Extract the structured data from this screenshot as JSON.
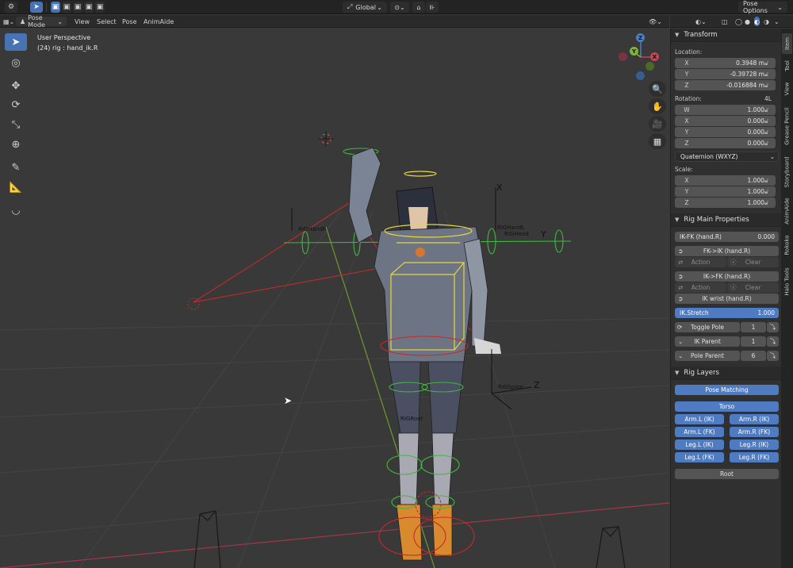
{
  "topbar": {
    "transform_orientation": "Global",
    "pose_options": "Pose Options"
  },
  "header": {
    "mode": "Pose Mode",
    "menu": [
      "View",
      "Select",
      "Pose",
      "AnimAide"
    ]
  },
  "viewport": {
    "view_name": "User Perspective",
    "object_info": "(24) rig : hand_ik.R",
    "bone_labels": [
      "RIGHandR",
      "RIGHandL",
      "RIGHead",
      "RIGSpine",
      "RIGRoot"
    ],
    "axis_labels": [
      "X",
      "Y",
      "Z"
    ],
    "gizmo": {
      "x": "X",
      "y": "Y",
      "z": "Z"
    },
    "colors": {
      "x_axis": "#c44454",
      "y_axis": "#7fb23b",
      "z_axis": "#4a7fc1",
      "bone_select": "#e8d83a",
      "bone_green": "#3fb93f",
      "bone_red": "#c42a2a"
    }
  },
  "toolbar": {
    "tools": [
      "select-box-icon",
      "cursor-icon",
      "move-icon",
      "rotate-icon",
      "scale-icon",
      "transform-icon",
      "annotate-icon",
      "measure-icon",
      "relax-icon"
    ]
  },
  "panel": {
    "transform": {
      "title": "Transform",
      "location_label": "Location:",
      "location": [
        {
          "axis": "X",
          "value": "0.3948 m"
        },
        {
          "axis": "Y",
          "value": "-0.39728 m"
        },
        {
          "axis": "Z",
          "value": "-0.016884 m"
        }
      ],
      "rotation_label": "Rotation:",
      "rotation_tag": "4L",
      "rotation": [
        {
          "axis": "W",
          "value": "1.000"
        },
        {
          "axis": "X",
          "value": "0.000"
        },
        {
          "axis": "Y",
          "value": "0.000"
        },
        {
          "axis": "Z",
          "value": "0.000"
        }
      ],
      "rotation_mode": "Quaternion (WXYZ)",
      "scale_label": "Scale:",
      "scale": [
        {
          "axis": "X",
          "value": "1.000"
        },
        {
          "axis": "Y",
          "value": "1.000"
        },
        {
          "axis": "Z",
          "value": "1.000"
        }
      ]
    },
    "rig_main": {
      "title": "Rig Main Properties",
      "ikfk_label": "IK-FK (hand.R)",
      "ikfk_value": "0.000",
      "fk_to_ik": "FK->IK (hand.R)",
      "action": "Action",
      "clear": "Clear",
      "ik_to_fk": "IK->FK (hand.R)",
      "ik_wrist": "IK wrist (hand.R)",
      "ik_stretch_label": "IK.Stretch",
      "ik_stretch_value": "1.000",
      "toggle_pole_label": "Toggle Pole",
      "toggle_pole_value": "1",
      "ik_parent_label": "IK Parent",
      "ik_parent_value": "1",
      "pole_parent_label": "Pole Parent",
      "pole_parent_value": "6"
    },
    "rig_layers": {
      "title": "Rig Layers",
      "pose_matching": "Pose Matching",
      "torso": "Torso",
      "arm_l_ik": "Arm.L (IK)",
      "arm_r_ik": "Arm.R (IK)",
      "arm_l_fk": "Arm.L (FK)",
      "arm_r_fk": "Arm.R (FK)",
      "leg_l_ik": "Leg.L (IK)",
      "leg_r_ik": "Leg.R (IK)",
      "leg_l_fk": "Leg.L (FK)",
      "leg_r_fk": "Leg.R (FK)",
      "root": "Root"
    }
  },
  "vtabs": [
    "Item",
    "Tool",
    "View",
    "Grease Pencil",
    "Storyboard",
    "AnimAide",
    "Rokoko",
    "Halo Tools"
  ]
}
